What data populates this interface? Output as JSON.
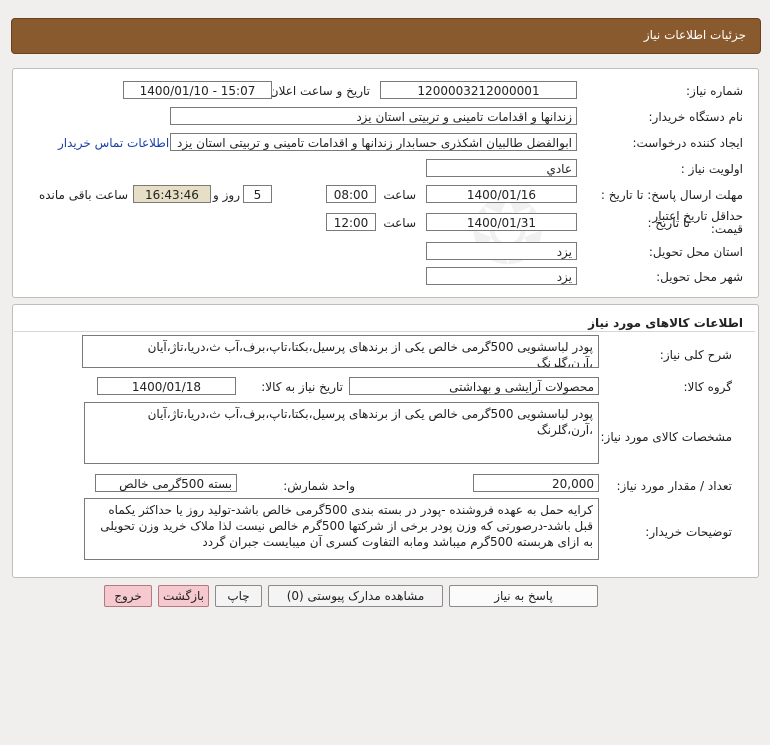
{
  "header": {
    "title": "جزئیات اطلاعات نیاز"
  },
  "info": {
    "need_number_label": "شماره نیاز:",
    "need_number": "1200003212000001",
    "announce_label": "تاریخ و ساعت اعلان عمومی:",
    "announce_value": "1400/01/10 - 15:07",
    "buyer_org_label": "نام دستگاه خریدار:",
    "buyer_org": "زندانها و اقدامات تامینی و تربیتی استان یزد",
    "requester_label": "ایجاد کننده درخواست:",
    "requester": "ابوالفضل  طالبیان اشکذری حسابدار زندانها و اقدامات تامینی و تربیتی استان یزد",
    "contact_link": "اطلاعات تماس خریدار",
    "priority_label": "اولویت نیاز :",
    "priority": "عادي",
    "deadline_label": "مهلت ارسال پاسخ:  تا تاریخ :",
    "deadline_date": "1400/01/16",
    "time_label": "ساعت",
    "deadline_time": "08:00",
    "days_value": "5",
    "days_label": "روز و",
    "remaining_time": "16:43:46",
    "remaining_label": "ساعت باقی مانده",
    "validity_label_1": "حداقل تاریخ اعتبار",
    "validity_label_2": "قیمت:",
    "validity_to_label": "تا تاریخ :",
    "validity_date": "1400/01/31",
    "validity_time_label": "ساعت",
    "validity_time": "12:00",
    "province_label": "استان محل تحویل:",
    "province": "یزد",
    "city_label": "شهر محل تحویل:",
    "city": "یزد"
  },
  "goods": {
    "section_title": "اطلاعات کالاهای مورد نیاز",
    "summary_label": "شرح کلی نیاز:",
    "summary": "پودر لباسشویی 500گرمی خالص یکی از برندهای پرسیل،بکتا،تاپ،برف،آب ث،دریا،تاژ،آیان ،آرن،گلرنگ",
    "group_label": "گروه کالا:",
    "group": "محصولات آرایشی و بهداشتی",
    "need_date_label": "تاریخ نیاز به کالا:",
    "need_date": "1400/01/18",
    "spec_label": "مشخصات کالای مورد نیاز:",
    "spec": "پودر لباسشویی 500گرمی خالص یکی از برندهای پرسیل،بکتا،تاپ،برف،آب ث،دریا،تاژ،آیان ،آرن،گلرنگ",
    "qty_label": "تعداد / مقدار مورد نیاز:",
    "qty": "20,000",
    "unit_label": "واحد شمارش:",
    "unit": "بسته 500گرمی خالص",
    "notes_label": "توضیحات خریدار:",
    "notes": "کرایه حمل به عهده فروشنده -پودر در بسته بندی 500گرمی خالص باشد-تولید روز یا حداکثر یکماه قبل باشد-درصورتی که وزن پودر برخی از شرکتها 500گرم خالص نیست لذا ملاک خرید وزن تحویلی به ازای هربسته 500گرم میباشد ومابه التفاوت کسری آن میبایست جبران گردد"
  },
  "buttons": {
    "reply": "پاسخ به نیاز",
    "attachments": "مشاهده مدارک پیوستی (0)",
    "print": "چاپ",
    "back": "بازگشت",
    "exit": "خروج"
  }
}
